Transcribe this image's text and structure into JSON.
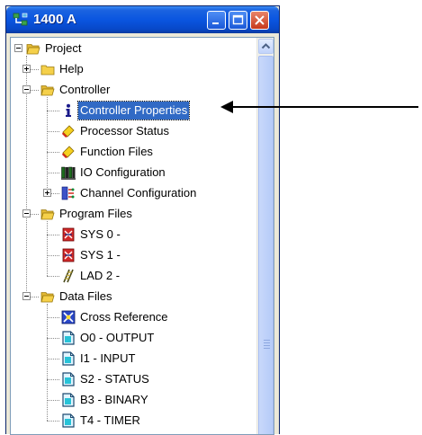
{
  "window": {
    "title": "1400 A",
    "icon": "app-network-icon"
  },
  "tree": [
    {
      "label": "Project",
      "icon": "folder-open-icon",
      "level": 0,
      "expander": "minus"
    },
    {
      "label": "Help",
      "icon": "folder-icon",
      "level": 1,
      "expander": "plus"
    },
    {
      "label": "Controller",
      "icon": "folder-open-icon",
      "level": 1,
      "expander": "minus"
    },
    {
      "label": "Controller Properties",
      "icon": "info-icon",
      "level": 2,
      "selected": true
    },
    {
      "label": "Processor Status",
      "icon": "processor-icon",
      "level": 2
    },
    {
      "label": "Function Files",
      "icon": "function-files-icon",
      "level": 2
    },
    {
      "label": "IO Configuration",
      "icon": "io-config-icon",
      "level": 2
    },
    {
      "label": "Channel Configuration",
      "icon": "channel-config-icon",
      "level": 2,
      "expander": "plus"
    },
    {
      "label": "Program Files",
      "icon": "folder-open-icon",
      "level": 1,
      "expander": "minus"
    },
    {
      "label": "SYS 0 -",
      "icon": "program-file-icon",
      "level": 2
    },
    {
      "label": "SYS 1 -",
      "icon": "program-file-icon",
      "level": 2
    },
    {
      "label": "LAD 2 -",
      "icon": "ladder-icon",
      "level": 2
    },
    {
      "label": "Data Files",
      "icon": "folder-open-icon",
      "level": 1,
      "expander": "minus"
    },
    {
      "label": "Cross Reference",
      "icon": "cross-reference-icon",
      "level": 2
    },
    {
      "label": "O0 - OUTPUT",
      "icon": "data-file-icon",
      "level": 2
    },
    {
      "label": "I1 - INPUT",
      "icon": "data-file-icon",
      "level": 2
    },
    {
      "label": "S2 - STATUS",
      "icon": "data-file-icon",
      "level": 2
    },
    {
      "label": "B3 - BINARY",
      "icon": "data-file-icon",
      "level": 2
    },
    {
      "label": "T4 - TIMER",
      "icon": "data-file-icon",
      "level": 2
    }
  ],
  "colors": {
    "selection": "#316ac5",
    "titlebar": "#0a55e0",
    "folder": "#f5d04a"
  }
}
